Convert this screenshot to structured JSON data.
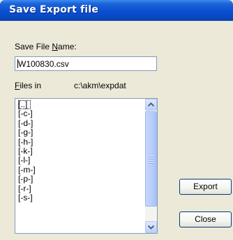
{
  "window": {
    "title": "Save Export file"
  },
  "save_file_name": {
    "label_prefix": "Save File ",
    "label_mnemonic": "N",
    "label_suffix": "ame:",
    "value": "W100830.csv"
  },
  "files_in": {
    "label_mnemonic": "F",
    "label_suffix": "iles in",
    "path": "c:\\akm\\expdat"
  },
  "file_list": {
    "items": [
      "[..]",
      "[-c-]",
      "[-d-]",
      "[-g-]",
      "[-h-]",
      "[-k-]",
      "[-l-]",
      "[-m-]",
      "[-p-]",
      "[-r-]",
      "[-s-]"
    ],
    "scroll_position": 0
  },
  "buttons": {
    "export": "Export",
    "close": "Close"
  },
  "colors": {
    "title_bar": "#0a4ed0",
    "dialog_bg": "#ece9d8",
    "field_border": "#7f9db9",
    "button_border": "#003c74"
  }
}
